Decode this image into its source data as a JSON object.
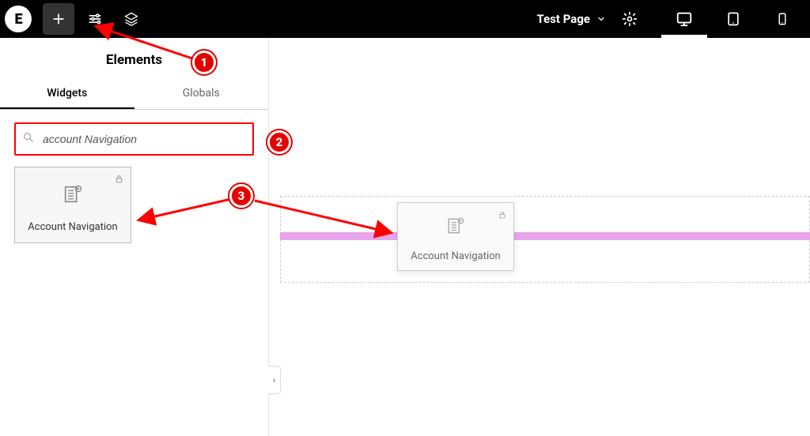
{
  "topbar": {
    "logo_text": "E",
    "page_label": "Test Page"
  },
  "sidebar": {
    "title": "Elements",
    "tabs": {
      "widgets": "Widgets",
      "globals": "Globals"
    },
    "search_value": "account Navigation"
  },
  "widget": {
    "label": "Account Navigation"
  },
  "ghost": {
    "label": "Account Navigation"
  },
  "callouts": {
    "c1": "1",
    "c2": "2",
    "c3": "3"
  },
  "collapse_glyph": "‹"
}
